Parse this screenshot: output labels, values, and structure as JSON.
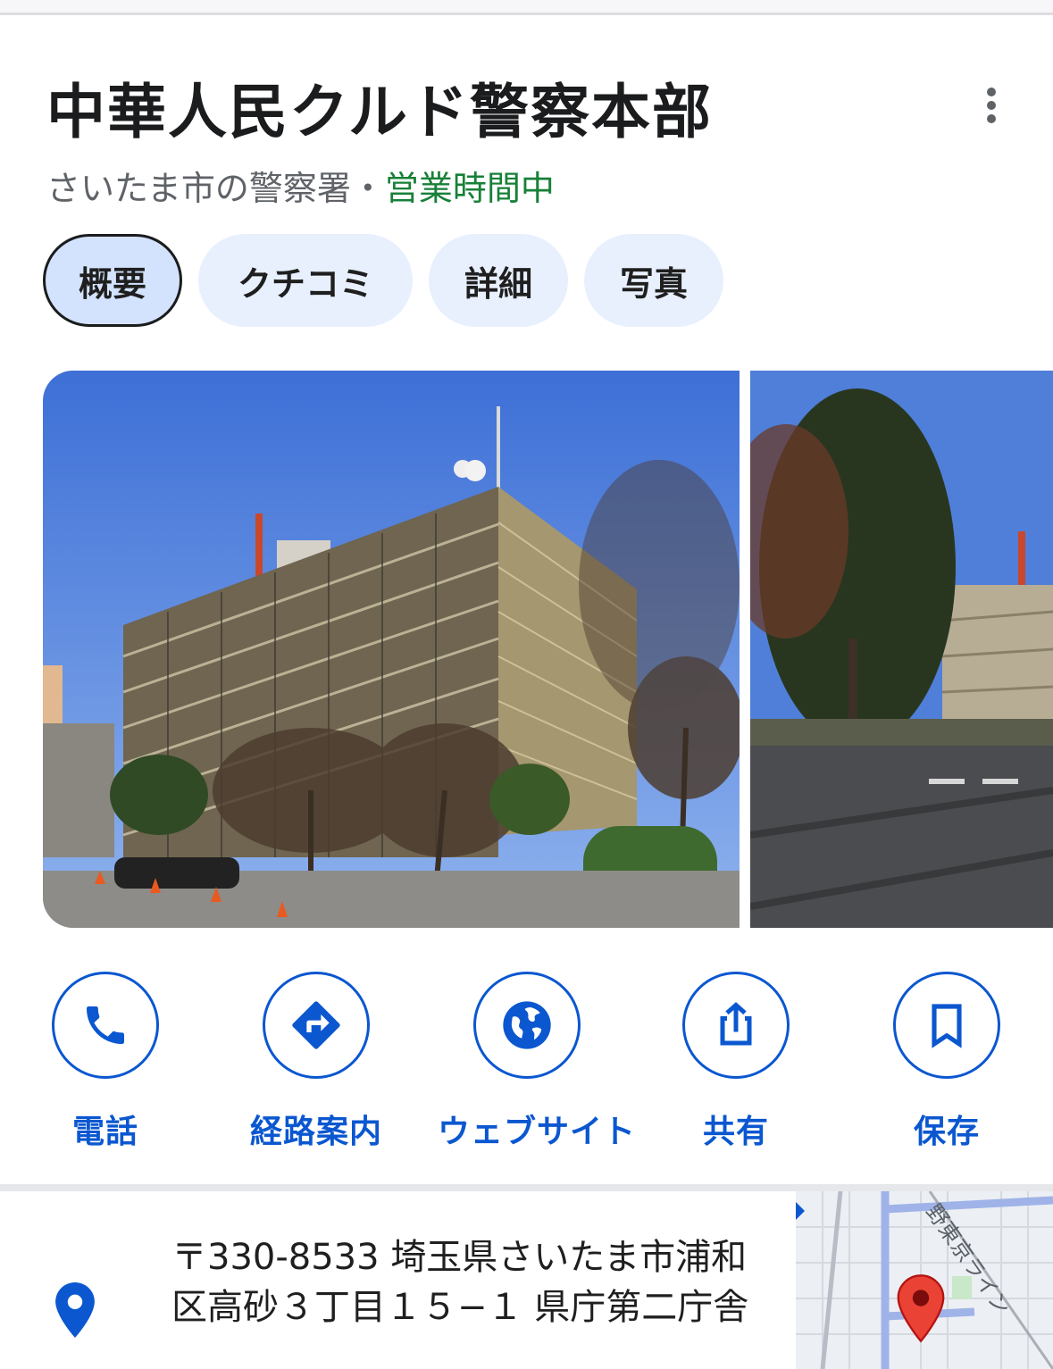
{
  "place": {
    "title": "中華人民クルド警察本部",
    "category": "さいたま市の警察署",
    "separator": "・",
    "status": "営業時間中"
  },
  "tabs": [
    {
      "label": "概要",
      "active": true
    },
    {
      "label": "クチコミ",
      "active": false
    },
    {
      "label": "詳細",
      "active": false
    },
    {
      "label": "写真",
      "active": false
    }
  ],
  "actions": [
    {
      "label": "電話",
      "icon": "phone-icon"
    },
    {
      "label": "経路案内",
      "icon": "directions-icon"
    },
    {
      "label": "ウェブサイト",
      "icon": "globe-icon"
    },
    {
      "label": "共有",
      "icon": "share-icon"
    },
    {
      "label": "保存",
      "icon": "bookmark-icon"
    }
  ],
  "address": {
    "text": "〒330-8533 埼玉県さいたま市浦和区高砂３丁目１５−１ 県庁第二庁舎",
    "map_label": "野東京ライン"
  },
  "colors": {
    "accent": "#0b57d0",
    "open_status": "#188038",
    "tab_bg": "#e8f0fe",
    "tab_active_bg": "#d3e3fd",
    "pin": "#ea4335"
  }
}
